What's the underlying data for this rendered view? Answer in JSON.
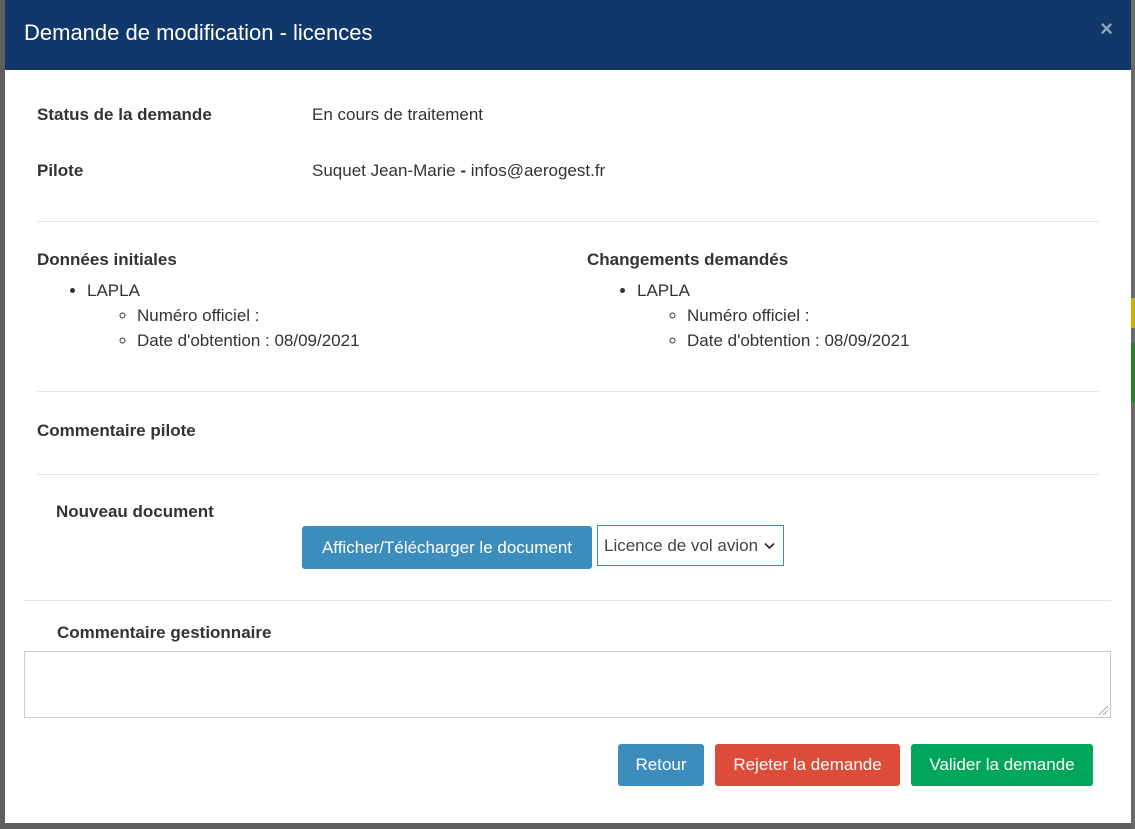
{
  "modal": {
    "title": "Demande de modification - licences",
    "close": "×"
  },
  "status": {
    "label": "Status de la demande",
    "value": "En cours de traitement"
  },
  "pilote": {
    "label": "Pilote",
    "name": "Suquet Jean-Marie",
    "sep": "-",
    "email": "infos@aerogest.fr"
  },
  "initial": {
    "heading": "Données initiales",
    "licence": "LAPLA",
    "numero": "Numéro officiel :",
    "date": "Date d'obtention : 08/09/2021"
  },
  "changes": {
    "heading": "Changements demandés",
    "licence": "LAPLA",
    "numero": "Numéro officiel :",
    "date": "Date d'obtention : 08/09/2021"
  },
  "comment_pilote": {
    "label": "Commentaire pilote"
  },
  "document": {
    "label": "Nouveau document",
    "button": "Afficher/Télécharger le document",
    "select_value": "Licence de vol avion"
  },
  "comment_gestionnaire": {
    "label": "Commentaire gestionnaire",
    "value": ""
  },
  "footer": {
    "back": "Retour",
    "reject": "Rejeter la demande",
    "validate": "Valider la demande"
  },
  "colors": {
    "header": "#12386b",
    "primary": "#3c8dbc",
    "danger": "#dd4b39",
    "success": "#00a65a"
  }
}
